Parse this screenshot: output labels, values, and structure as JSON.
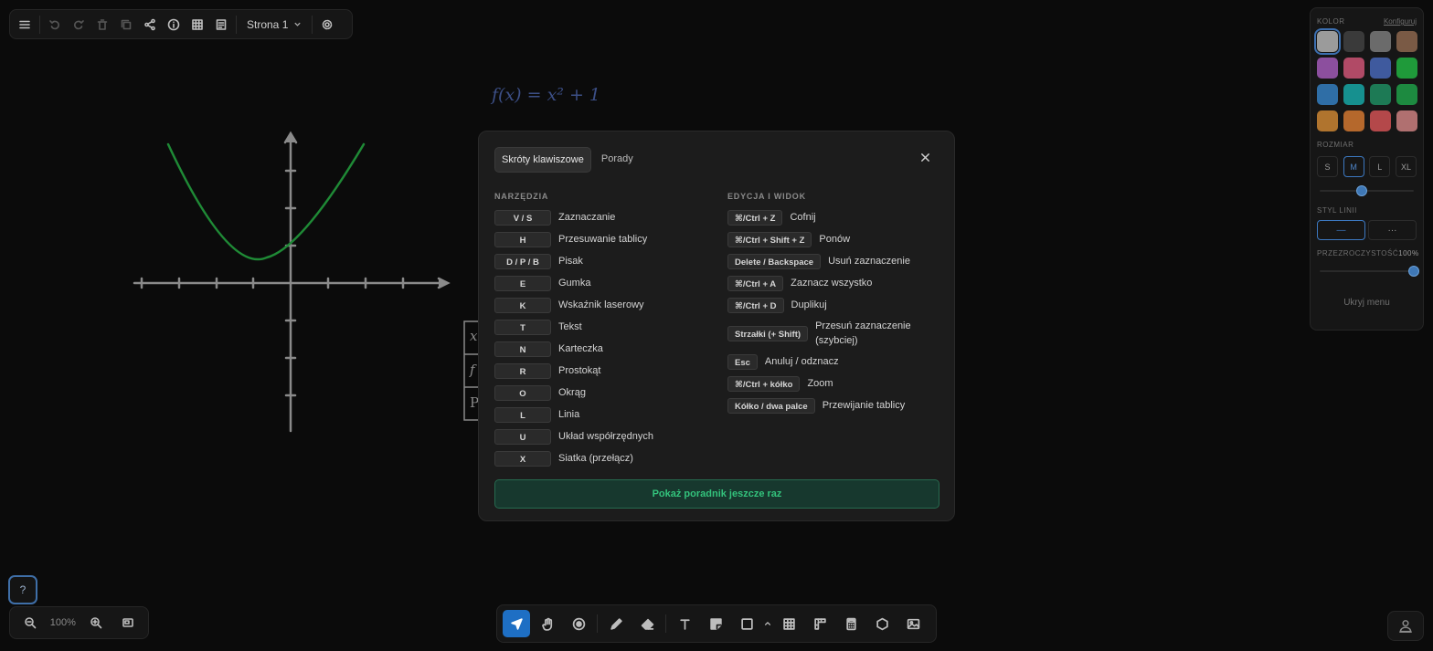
{
  "top_toolbar": {
    "page_label": "Strona 1"
  },
  "canvas": {
    "formula": "f(x) = x² + 1",
    "table_row_initials": [
      "x",
      "f",
      "P"
    ]
  },
  "style_panel": {
    "color_label": "KOLOR",
    "configure_link": "Konfiguruj",
    "colors": [
      "#9b9b9b",
      "#3a3a3a",
      "#6b6b6b",
      "#7a5a45",
      "#8c4f9e",
      "#b14a66",
      "#3f5a9e",
      "#1f9a3a",
      "#2f6ea6",
      "#16908f",
      "#1d7a55",
      "#1d8a40",
      "#b0742e",
      "#b5682c",
      "#b4484a",
      "#b07070"
    ],
    "selected_color_index": 0,
    "size_label": "ROZMIAR",
    "sizes": [
      "S",
      "M",
      "L",
      "XL"
    ],
    "selected_size": "M",
    "size_slider_fraction": 0.45,
    "line_style_label": "STYL LINII",
    "line_styles": [
      "—",
      "···"
    ],
    "opacity_label": "PRZEZROCZYSTOŚĆ",
    "opacity_value": "100%",
    "opacity_fraction": 1.0,
    "hide_menu_label": "Ukryj menu"
  },
  "modal": {
    "tabs": [
      "Skróty klawiszowe",
      "Porady"
    ],
    "active_tab": 0,
    "tools_title": "NARZĘDZIA",
    "tools": [
      {
        "key": "V / S",
        "label": "Zaznaczanie"
      },
      {
        "key": "H",
        "label": "Przesuwanie tablicy"
      },
      {
        "key": "D / P / B",
        "label": "Pisak"
      },
      {
        "key": "E",
        "label": "Gumka"
      },
      {
        "key": "K",
        "label": "Wskaźnik laserowy"
      },
      {
        "key": "T",
        "label": "Tekst"
      },
      {
        "key": "N",
        "label": "Karteczka"
      },
      {
        "key": "R",
        "label": "Prostokąt"
      },
      {
        "key": "O",
        "label": "Okrąg"
      },
      {
        "key": "L",
        "label": "Linia"
      },
      {
        "key": "U",
        "label": "Układ współrzędnych"
      },
      {
        "key": "X",
        "label": "Siatka (przełącz)"
      }
    ],
    "edit_title": "EDYCJA I WIDOK",
    "edit": [
      {
        "key": "⌘/Ctrl + Z",
        "label": "Cofnij"
      },
      {
        "key": "⌘/Ctrl + Shift + Z",
        "label": "Ponów"
      },
      {
        "key": "Delete / Backspace",
        "label": "Usuń zaznaczenie"
      },
      {
        "key": "⌘/Ctrl + A",
        "label": "Zaznacz wszystko"
      },
      {
        "key": "⌘/Ctrl + D",
        "label": "Duplikuj"
      },
      {
        "key": "Strzałki (+ Shift)",
        "label": "Przesuń zaznaczenie (szybciej)"
      },
      {
        "key": "Esc",
        "label": "Anuluj / odznacz"
      },
      {
        "key": "⌘/Ctrl + kółko",
        "label": "Zoom"
      },
      {
        "key": "Kółko / dwa palce",
        "label": "Przewijanie tablicy"
      }
    ],
    "tutorial_button": "Pokaż poradnik jeszcze raz"
  },
  "help_button": "?",
  "zoom": {
    "level": "100%"
  }
}
